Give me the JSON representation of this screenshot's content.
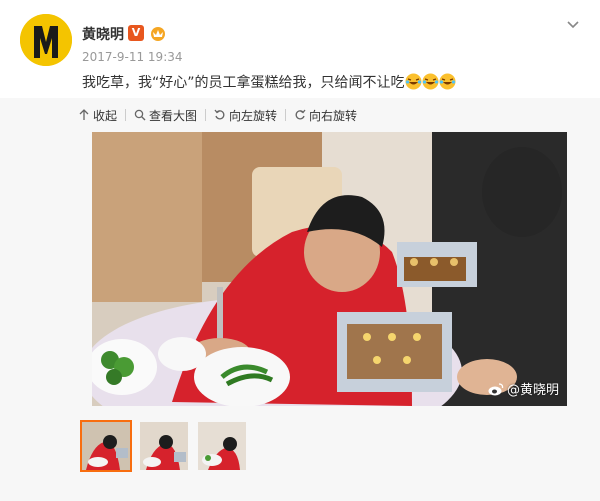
{
  "post": {
    "username": "黄晓明",
    "verified_badge": "V",
    "timestamp": "2017-9-11 19:34",
    "text": "我吃草，我“好心”的员工拿蛋糕给我，只给闻不让吃",
    "emoji_count": 3
  },
  "toolbar": {
    "collapse": "收起",
    "view_large": "查看大图",
    "rotate_left": "向左旋转",
    "rotate_right": "向右旋转"
  },
  "photo": {
    "watermark": "@黄晓明"
  },
  "thumbnails": {
    "count": 3,
    "active_index": 0
  },
  "colors": {
    "accent": "#f86d0f",
    "avatar_bg": "#f4c400",
    "badge_bg": "#e8571e",
    "muted_text": "#999999"
  }
}
